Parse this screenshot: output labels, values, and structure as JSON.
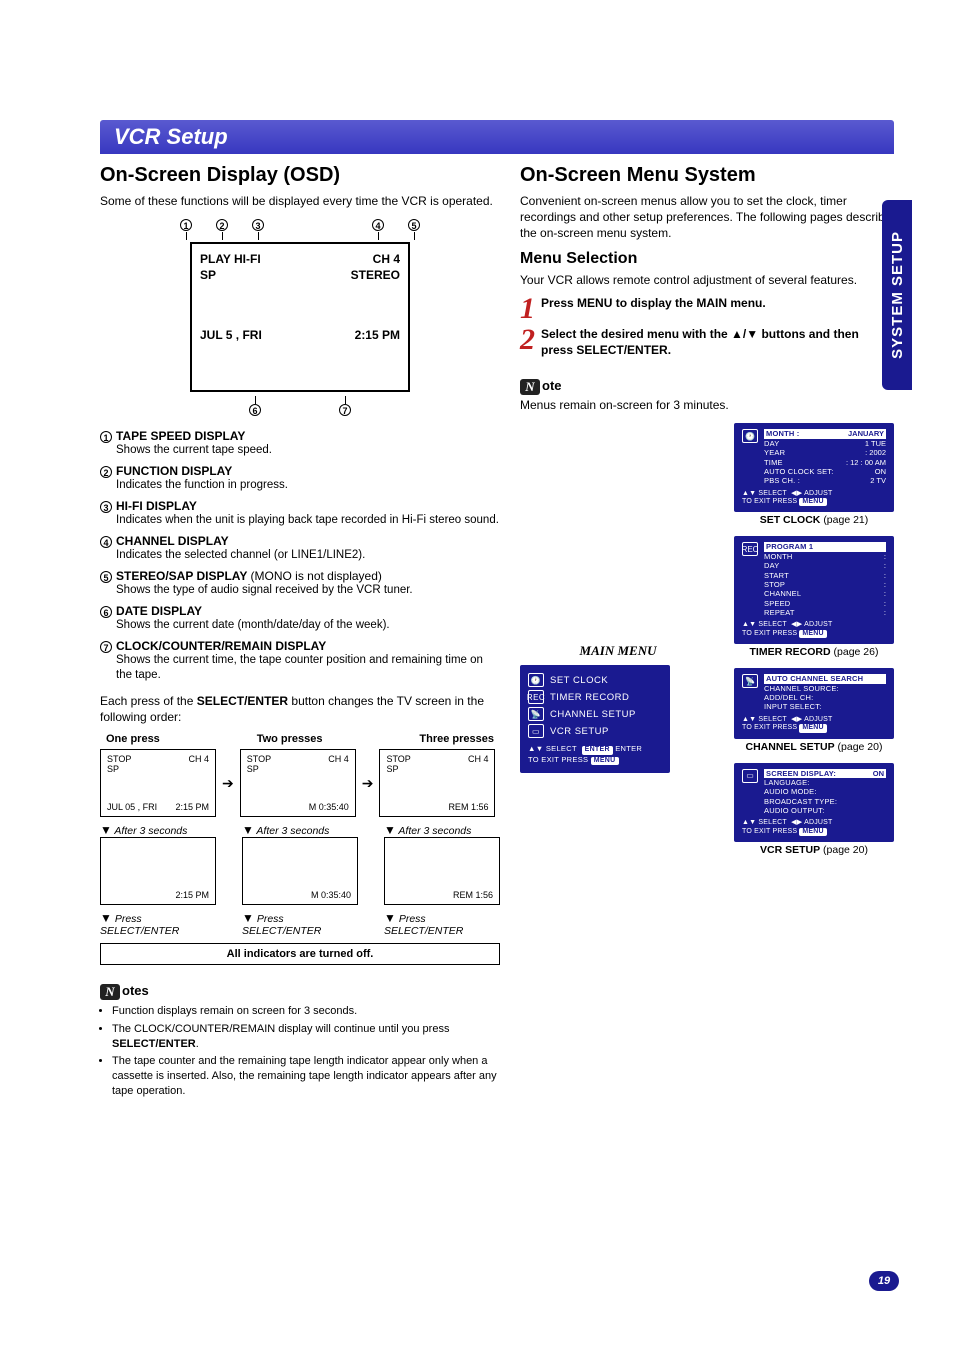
{
  "side_tab": "SYSTEM SETUP",
  "page_number": "19",
  "section_bar": "VCR Setup",
  "left": {
    "h1": "On-Screen Display (OSD)",
    "intro": "Some of these functions will be displayed every time the VCR is operated.",
    "osd": {
      "callouts_top": [
        "1",
        "2",
        "3",
        "4",
        "5"
      ],
      "row1_left": "PLAY HI-FI",
      "row1_right": "CH  4",
      "row2_left": "SP",
      "row2_right": "STEREO",
      "row3_left": "JUL  5 , FRI",
      "row3_right": "2:15 PM",
      "callouts_bottom": [
        "6",
        "7"
      ]
    },
    "callouts_side_arrow_for": "STEREO",
    "defns": [
      {
        "n": "1",
        "title": "TAPE SPEED DISPLAY",
        "body": "Shows the current tape speed."
      },
      {
        "n": "2",
        "title": "FUNCTION DISPLAY",
        "body": "Indicates the function in progress."
      },
      {
        "n": "3",
        "title": "HI-FI DISPLAY",
        "body": "Indicates when the unit is playing back tape recorded in Hi-Fi stereo sound."
      },
      {
        "n": "4",
        "title": "CHANNEL DISPLAY",
        "body": "Indicates the selected channel (or LINE1/LINE2)."
      },
      {
        "n": "5",
        "title": "STEREO/SAP DISPLAY",
        "extra": "(MONO is not displayed)",
        "body": "Shows the type of audio signal received by the VCR tuner."
      },
      {
        "n": "6",
        "title": "DATE DISPLAY",
        "body": "Shows the current date (month/date/day of the week)."
      },
      {
        "n": "7",
        "title": "CLOCK/COUNTER/REMAIN DISPLAY",
        "body": "Shows the current time, the tape counter position and remaining time on the tape."
      }
    ],
    "select_enter_para_pre": "Each press of the ",
    "select_enter_bold": "SELECT/ENTER",
    "select_enter_para_post": " button changes the TV screen in the following order:",
    "seq_headers": [
      "One press",
      "Two presses",
      "Three presses"
    ],
    "seq": {
      "row1": [
        {
          "tl": "STOP",
          "tr": "CH  4",
          "bl": "SP",
          "br": "",
          "fl": "JUL  05 , FRI",
          "fr": "2:15 PM"
        },
        {
          "tl": "STOP",
          "tr": "CH  4",
          "bl": "SP",
          "br": "",
          "fl": "",
          "fr": "M 0:35:40"
        },
        {
          "tl": "STOP",
          "tr": "CH  4",
          "bl": "SP",
          "br": "",
          "fl": "",
          "fr": "REM 1:56"
        }
      ],
      "after3": "After 3 seconds",
      "row2": [
        {
          "fl": "",
          "fr": "2:15 PM"
        },
        {
          "fl": "",
          "fr": "M 0:35:40"
        },
        {
          "fl": "",
          "fr": "REM 1:56"
        }
      ],
      "press_caption_pre": "Press",
      "press_caption": "SELECT/ENTER",
      "all_off": "All indicators are turned off."
    },
    "notes_label": "otes",
    "notes": [
      "Function displays remain on screen for 3 seconds.",
      "The CLOCK/COUNTER/REMAIN display will continue until you press SELECT/ENTER.",
      "The tape counter and the remaining tape length indicator appear only when a cassette is inserted. Also, the remaining tape length indicator appears after any tape operation."
    ],
    "notes_bold_in_1": "SELECT/ENTER"
  },
  "right": {
    "h1": "On-Screen Menu System",
    "intro": "Convenient on-screen menus allow you to set the clock, timer recordings and other setup preferences. The following pages describe the on-screen menu system.",
    "h2": "Menu Selection",
    "sub": "Your VCR allows remote control adjustment of several features.",
    "step1": "Press MENU to display the MAIN menu.",
    "step2": "Select the desired menu with the ▲/▼ buttons and then press SELECT/ENTER.",
    "note_label": "ote",
    "note": "Menus remain on-screen for 3 minutes.",
    "main_menu": {
      "title": "MAIN MENU",
      "items": [
        "SET  CLOCK",
        "TIMER  RECORD",
        "CHANNEL  SETUP",
        "VCR  SETUP"
      ],
      "foot_select": "SELECT",
      "foot_enter": "ENTER",
      "foot_enter_pill": "ENTER",
      "foot_exit": "TO  EXIT   PRESS",
      "foot_menu_pill": "MENU"
    },
    "sub_menus": [
      {
        "icon": "clock",
        "rows": [
          {
            "l": "MONTH  :",
            "r": "JANUARY",
            "hl": true
          },
          {
            "l": "DAY",
            "r": "1   TUE"
          },
          {
            "l": "YEAR",
            "r": ":       2002"
          },
          {
            "l": "TIME",
            "r": ":   12 : 00   AM"
          },
          {
            "l": "AUTO CLOCK SET:",
            "r": "ON"
          },
          {
            "l": "PBS CH. :",
            "r": "2        TV"
          }
        ],
        "foot_sel": "SELECT",
        "foot_adj": "ADJUST",
        "foot_exit": "TO  EXIT   PRESS",
        "foot_pill": "MENU",
        "caption_bold": "SET CLOCK",
        "caption_page": "(page 21)"
      },
      {
        "icon": "rec",
        "headline": "PROGRAM   1",
        "rows": [
          {
            "l": "MONTH",
            "r": ":"
          },
          {
            "l": "DAY",
            "r": ":"
          },
          {
            "l": "START",
            "r": ":"
          },
          {
            "l": "STOP",
            "r": ":"
          },
          {
            "l": "CHANNEL",
            "r": ":"
          },
          {
            "l": "SPEED",
            "r": ":"
          },
          {
            "l": "REPEAT",
            "r": ":"
          }
        ],
        "foot_sel": "SELECT",
        "foot_adj": "ADJUST",
        "foot_exit": "TO  EXIT   PRESS",
        "foot_pill": "MENU",
        "caption_bold": "TIMER RECORD",
        "caption_page": "(page 26)"
      },
      {
        "icon": "antenna",
        "rows": [
          {
            "l": "AUTO  CHANNEL  SEARCH",
            "r": "",
            "hl": true
          },
          {
            "l": "CHANNEL SOURCE:",
            "r": ""
          },
          {
            "l": "ADD/DEL CH:",
            "r": ""
          },
          {
            "l": "INPUT SELECT:",
            "r": ""
          }
        ],
        "foot_sel": "SELECT",
        "foot_adj": "ADJUST",
        "foot_exit": "TO  EXIT   PRESS",
        "foot_pill": "MENU",
        "caption_bold": "CHANNEL SETUP",
        "caption_page": "(page 20)"
      },
      {
        "icon": "vcr",
        "rows": [
          {
            "l": "SCREEN  DISPLAY:",
            "r": "ON",
            "hl": true
          },
          {
            "l": "LANGUAGE:",
            "r": ""
          },
          {
            "l": "AUDIO MODE:",
            "r": ""
          },
          {
            "l": "BROADCAST  TYPE:",
            "r": ""
          },
          {
            "l": "AUDIO OUTPUT:",
            "r": ""
          }
        ],
        "foot_sel": "SELECT",
        "foot_adj": "ADJUST",
        "foot_exit": "TO  EXIT   PRESS",
        "foot_pill": "MENU",
        "caption_bold": "VCR SETUP",
        "caption_page": "(page 20)"
      }
    ]
  }
}
